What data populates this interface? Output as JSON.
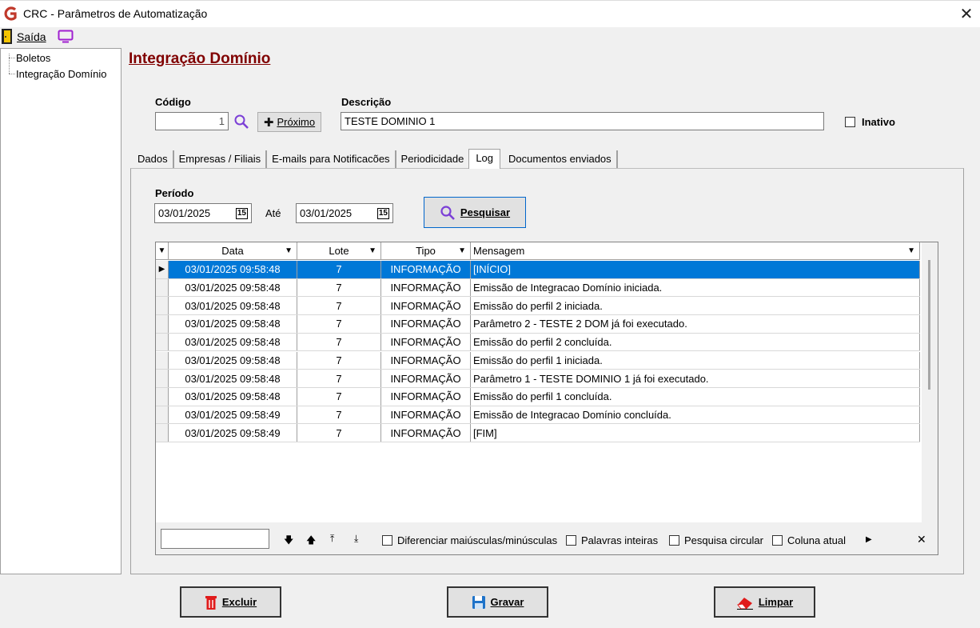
{
  "window": {
    "title": "CRC - Parâmetros de Automatização",
    "close_icon": "close-icon"
  },
  "menu": {
    "exit_label": "Saída",
    "exit_icon": "door-exit-icon",
    "screen_icon": "monitor-icon"
  },
  "tree": {
    "items": [
      {
        "label": "Boletos"
      },
      {
        "label": "Integração Domínio"
      }
    ]
  },
  "page": {
    "title": "Integração Domínio"
  },
  "form": {
    "codigo_label": "Código",
    "codigo_value": "1",
    "next_button": "Próximo",
    "descricao_label": "Descrição",
    "descricao_value": "TESTE DOMINIO 1",
    "inativo_label": "Inativo",
    "inativo_checked": false
  },
  "tabs": [
    {
      "label": "Dados",
      "active": false
    },
    {
      "label": "Empresas / Filiais",
      "active": false
    },
    {
      "label": "E-mails para Notificacões",
      "active": false
    },
    {
      "label": "Periodicidade",
      "active": false
    },
    {
      "label": "Log",
      "active": true
    },
    {
      "label": "Documentos enviados",
      "active": false
    }
  ],
  "log": {
    "periodo_label": "Período",
    "date_from": "03/01/2025",
    "ate_label": "Até",
    "date_to": "03/01/2025",
    "search_button": "Pesquisar",
    "columns": [
      {
        "label": "Data"
      },
      {
        "label": "Lote"
      },
      {
        "label": "Tipo"
      },
      {
        "label": "Mensagem"
      }
    ],
    "rows": [
      {
        "data": "03/01/2025 09:58:48",
        "lote": "7",
        "tipo": "INFORMAÇÃO",
        "mensagem": "[INÍCIO]"
      },
      {
        "data": "03/01/2025 09:58:48",
        "lote": "7",
        "tipo": "INFORMAÇÃO",
        "mensagem": "Emissão de Integracao Domínio iniciada."
      },
      {
        "data": "03/01/2025 09:58:48",
        "lote": "7",
        "tipo": "INFORMAÇÃO",
        "mensagem": "Emissão do perfil 2 iniciada."
      },
      {
        "data": "03/01/2025 09:58:48",
        "lote": "7",
        "tipo": "INFORMAÇÃO",
        "mensagem": "Parâmetro 2 - TESTE 2 DOM já foi executado."
      },
      {
        "data": "03/01/2025 09:58:48",
        "lote": "7",
        "tipo": "INFORMAÇÃO",
        "mensagem": "Emissão do perfil 2 concluída."
      },
      {
        "data": "03/01/2025 09:58:48",
        "lote": "7",
        "tipo": "INFORMAÇÃO",
        "mensagem": "Emissão do perfil 1 iniciada."
      },
      {
        "data": "03/01/2025 09:58:48",
        "lote": "7",
        "tipo": "INFORMAÇÃO",
        "mensagem": "Parâmetro 1 - TESTE DOMINIO 1 já foi executado."
      },
      {
        "data": "03/01/2025 09:58:48",
        "lote": "7",
        "tipo": "INFORMAÇÃO",
        "mensagem": "Emissão do perfil 1 concluída."
      },
      {
        "data": "03/01/2025 09:58:49",
        "lote": "7",
        "tipo": "INFORMAÇÃO",
        "mensagem": "Emissão de Integracao Domínio concluída."
      },
      {
        "data": "03/01/2025 09:58:49",
        "lote": "7",
        "tipo": "INFORMAÇÃO",
        "mensagem": "[FIM]"
      }
    ],
    "selected_row": 0,
    "find": {
      "value": "",
      "opt_case": "Diferenciar maiúsculas/minúsculas",
      "opt_whole": "Palavras inteiras",
      "opt_circular": "Pesquisa circular",
      "opt_column": "Coluna atual"
    }
  },
  "actions": {
    "delete": "Excluir",
    "save": "Gravar",
    "clear": "Limpar"
  },
  "colors": {
    "title_accent": "#800000",
    "selection": "#0078d7",
    "search_icon": "#7b3fd6"
  }
}
